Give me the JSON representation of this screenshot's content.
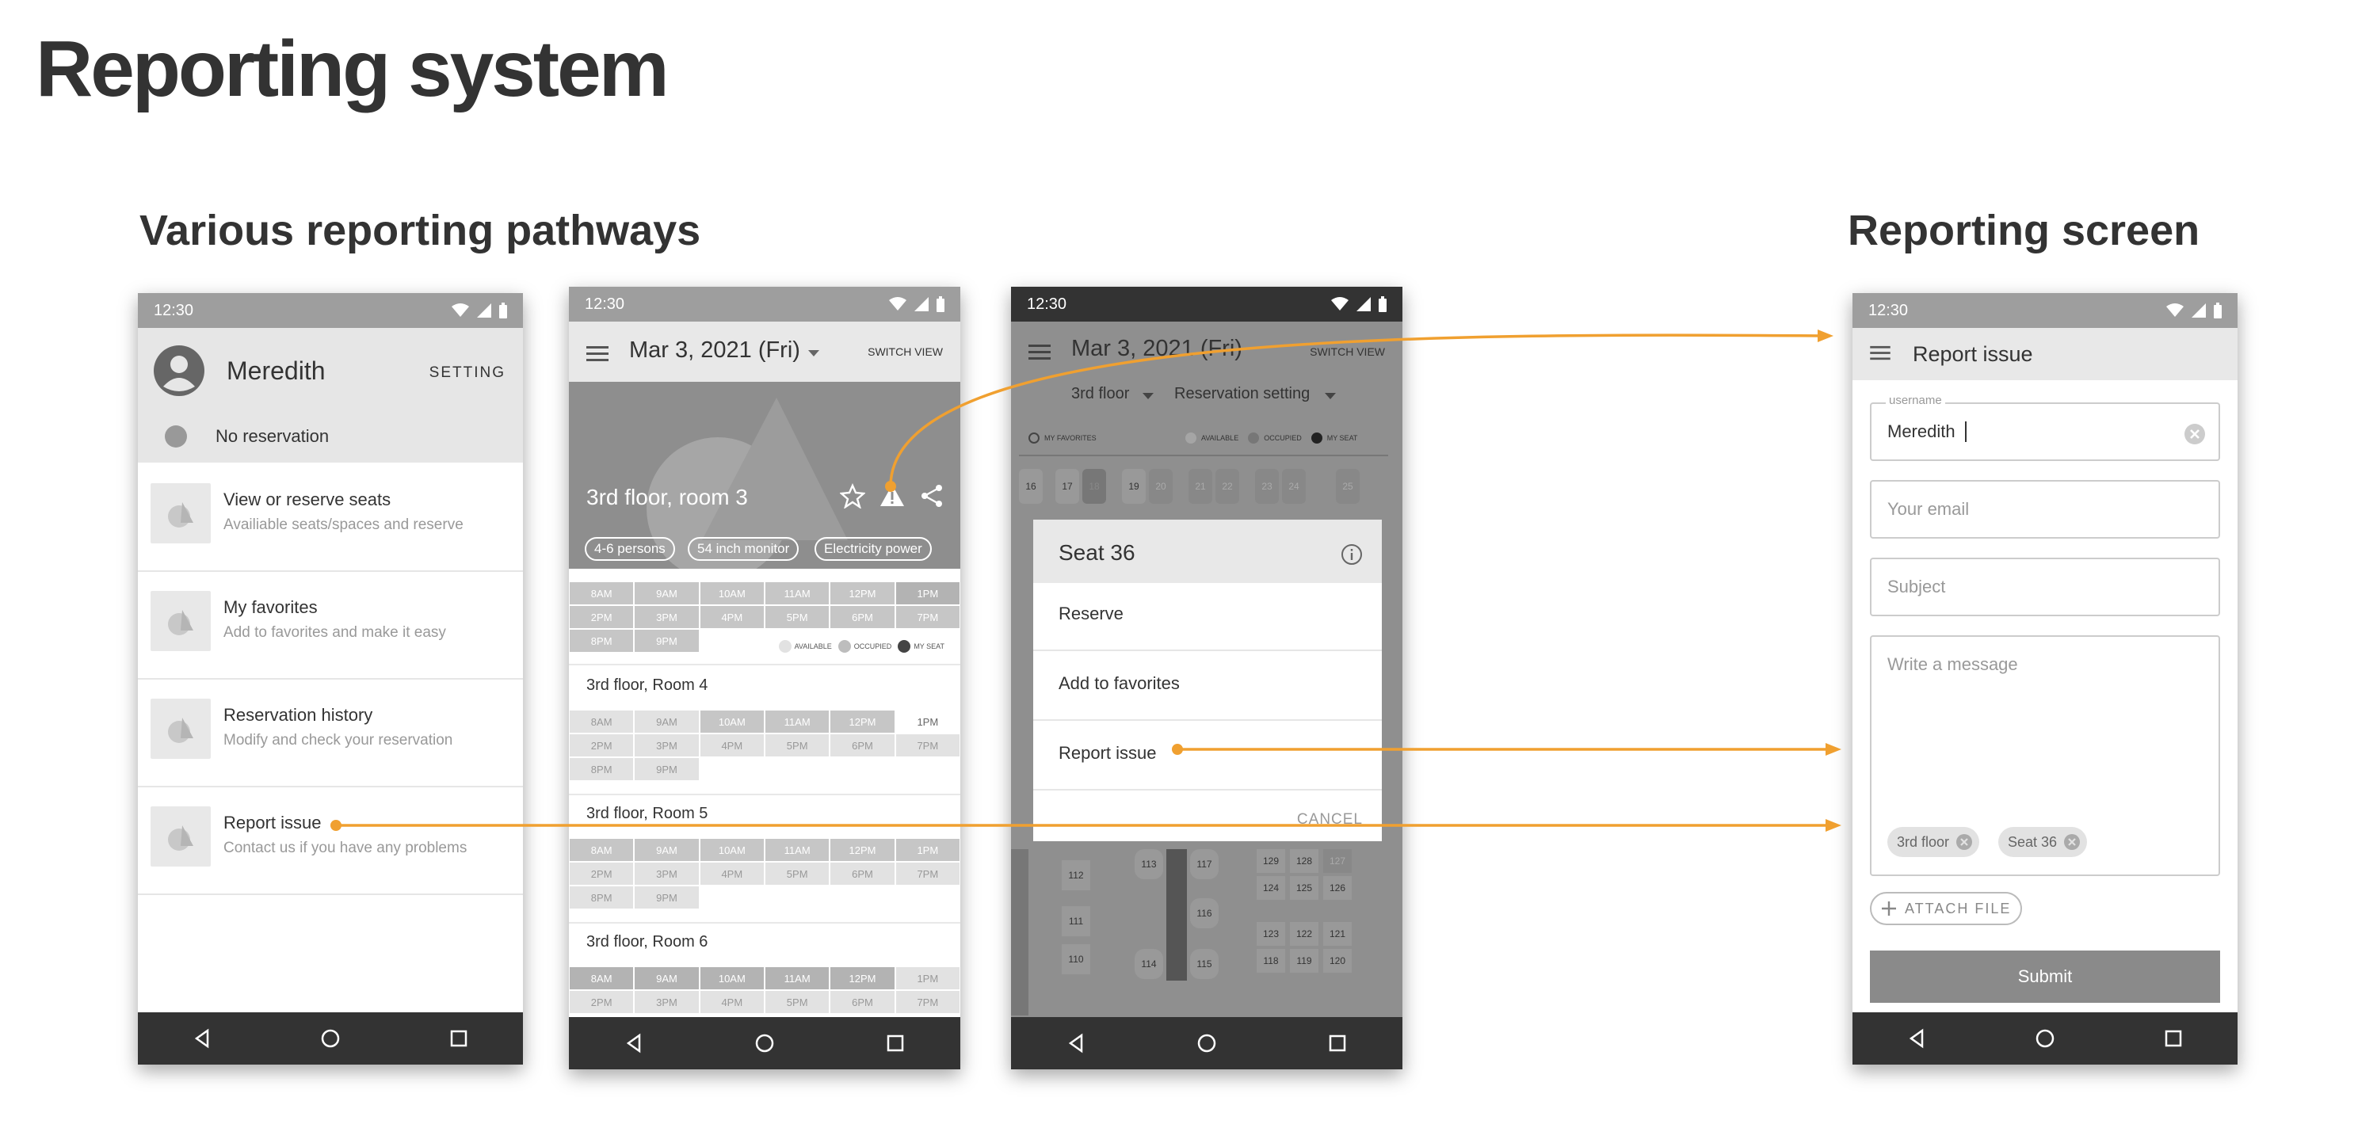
{
  "page": {
    "title": "Reporting system",
    "section_left": "Various reporting pathways",
    "section_right": "Reporting screen"
  },
  "phone1": {
    "time": "12:30",
    "user_name": "Meredith",
    "setting_label": "SETTING",
    "reservation_status": "No reservation",
    "menu": [
      {
        "label": "View or reserve seats",
        "sub": "Availiable seats/spaces and reserve"
      },
      {
        "label": "My favorites",
        "sub": "Add to favorites and make it easy"
      },
      {
        "label": "Reservation history",
        "sub": "Modify and check your reservation"
      },
      {
        "label": "Report issue",
        "sub": "Contact us if you have any problems"
      }
    ]
  },
  "phone2": {
    "time": "12:30",
    "date": "Mar 3, 2021 (Fri)",
    "switch_view": "SWITCH VIEW",
    "room_title": "3rd floor, room 3",
    "chips": [
      "4-6 persons",
      "54 inch monitor",
      "Electricity power"
    ],
    "times_row1": [
      "8AM",
      "9AM",
      "10AM",
      "11AM",
      "12PM",
      "1PM"
    ],
    "times_row2": [
      "2PM",
      "3PM",
      "4PM",
      "5PM",
      "6PM",
      "7PM"
    ],
    "times_row3": [
      "8PM",
      "9PM"
    ],
    "legend": [
      "AVAILABLE",
      "OCCUPIED",
      "MY SEAT"
    ],
    "rooms": [
      "3rd floor, Room 4",
      "3rd floor, Room 5",
      "3rd floor, Room 6"
    ]
  },
  "phone3": {
    "time": "12:30",
    "date": "Mar 3, 2021 (Fri)",
    "switch_view": "SWITCH VIEW",
    "floor_select": "3rd floor",
    "reservation_setting": "Reservation setting",
    "legend": [
      "MY FAVORITES",
      "AVAILABLE",
      "OCCUPIED",
      "MY SEAT"
    ],
    "seat_row": [
      "16",
      "17",
      "18",
      "19",
      "20",
      "21",
      "22",
      "23",
      "24",
      "25"
    ],
    "seats_bottom": [
      "112",
      "113",
      "117",
      "129",
      "128",
      "127",
      "124",
      "125",
      "126",
      "111",
      "116",
      "110",
      "114",
      "115",
      "123",
      "122",
      "121",
      "118",
      "119",
      "120"
    ],
    "dialog": {
      "title": "Seat 36",
      "options": [
        "Reserve",
        "Add to favorites",
        "Report issue"
      ],
      "cancel": "CANCEL"
    }
  },
  "phone4": {
    "time": "12:30",
    "title": "Report issue",
    "username_label": "username",
    "username_value": "Meredith",
    "email_placeholder": "Your email",
    "subject_placeholder": "Subject",
    "message_placeholder": "Write a message",
    "tags": [
      "3rd floor",
      "Seat 36"
    ],
    "attach_label": "ATTACH FILE",
    "submit_label": "Submit"
  },
  "colors": {
    "accent": "#f0a030",
    "dark": "#333333",
    "status_bar": "#9e9e9e"
  }
}
